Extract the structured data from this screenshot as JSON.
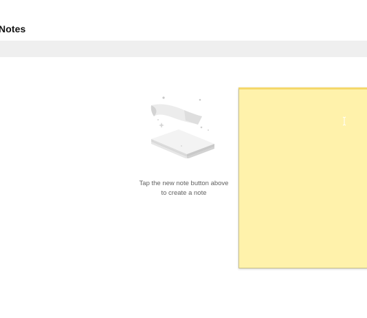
{
  "app": {
    "title": "Notes"
  },
  "empty_state": {
    "message_line1": "Tap the new note button above",
    "message_line2": "to create a note",
    "illustration_icon": "empty-notes-illustration-icon"
  },
  "note": {
    "background": "#fff2ab",
    "accent": "#f5d86a"
  },
  "search": {
    "background": "#efefef"
  }
}
